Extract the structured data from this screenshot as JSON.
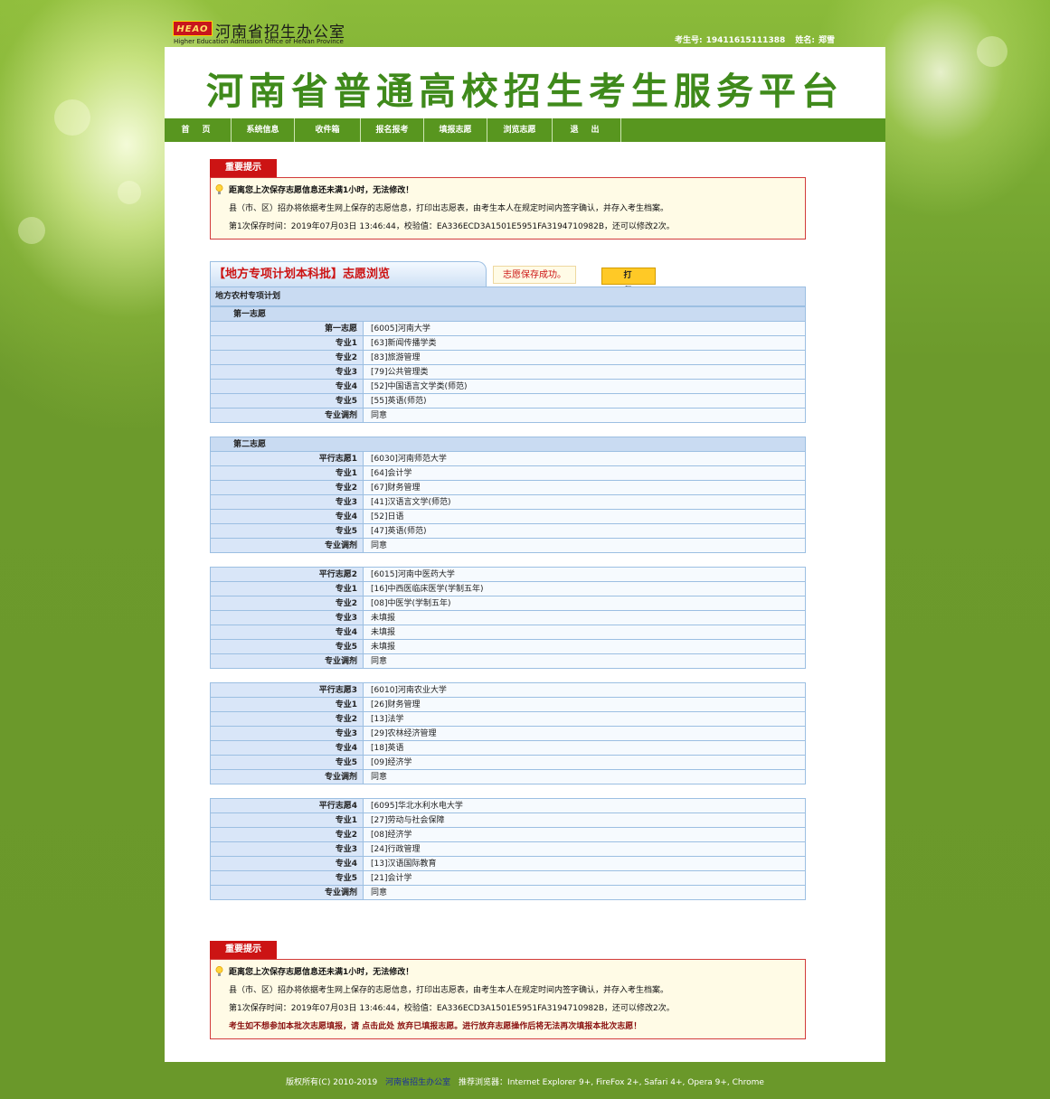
{
  "header": {
    "logo_badge": "HEAO",
    "logo_cn": "河南省招生办公室",
    "logo_en": "Higher Education Admission Office of HeNan Province",
    "exam_no_label": "考生号:",
    "exam_no": "19411615111388",
    "name_label": "姓名:",
    "name": "郑雪"
  },
  "banner_title": "河南省普通高校招生考生服务平台",
  "nav": [
    "首页",
    "系统信息",
    "收件箱",
    "报名报考",
    "填报志愿",
    "浏览志愿",
    "退出"
  ],
  "notice_top": {
    "tab": "重要提示",
    "lines": [
      "距离您上次保存志愿信息还未满1小时，无法修改！",
      "县（市、区）招办将依据考生网上保存的志愿信息，打印出志愿表，由考生本人在规定时间内签字确认，并存入考生档案。",
      "第1次保存时间：2019年07月03日 13:46:44，校验值：EA336ECD3A1501E5951FA3194710982B，还可以修改2次。"
    ]
  },
  "browse": {
    "title": "【地方专项计划本科批】志愿浏览",
    "saved_msg": "志愿保存成功。",
    "print_label": "打印"
  },
  "plan_title": "地方农村专项计划",
  "groups": [
    {
      "label": "第一志愿",
      "school_key": "第一志愿",
      "school": "[6005]河南大学",
      "majors": [
        "[63]新闻传播学类",
        "[83]旅游管理",
        "[79]公共管理类",
        "[52]中国语言文学类(师范)",
        "[55]英语(师范)"
      ],
      "adjust": "同意"
    },
    {
      "label": "第二志愿",
      "school_key": "平行志愿1",
      "school": "[6030]河南师范大学",
      "majors": [
        "[64]会计学",
        "[67]财务管理",
        "[41]汉语言文学(师范)",
        "[52]日语",
        "[47]英语(师范)"
      ],
      "adjust": "同意"
    },
    {
      "label": "",
      "school_key": "平行志愿2",
      "school": "[6015]河南中医药大学",
      "majors": [
        "[16]中西医临床医学(学制五年)",
        "[08]中医学(学制五年)",
        "未填报",
        "未填报",
        "未填报"
      ],
      "adjust": "同意"
    },
    {
      "label": "",
      "school_key": "平行志愿3",
      "school": "[6010]河南农业大学",
      "majors": [
        "[26]财务管理",
        "[13]法学",
        "[29]农林经济管理",
        "[18]英语",
        "[09]经济学"
      ],
      "adjust": "同意"
    },
    {
      "label": "",
      "school_key": "平行志愿4",
      "school": "[6095]华北水利水电大学",
      "majors": [
        "[27]劳动与社会保障",
        "[08]经济学",
        "[24]行政管理",
        "[13]汉语国际教育",
        "[21]会计学"
      ],
      "adjust": "同意"
    }
  ],
  "major_labels": [
    "专业1",
    "专业2",
    "专业3",
    "专业4",
    "专业5"
  ],
  "adjust_label": "专业调剂",
  "notice_bottom": {
    "tab": "重要提示",
    "lines": [
      "距离您上次保存志愿信息还未满1小时，无法修改！",
      "县（市、区）招办将依据考生网上保存的志愿信息，打印出志愿表，由考生本人在规定时间内签字确认，并存入考生档案。",
      "第1次保存时间：2019年07月03日 13:46:44，校验值：EA336ECD3A1501E5951FA3194710982B，还可以修改2次。",
      "考生如不想参加本批次志愿填报，请 点击此处 放弃已填报志愿。进行放弃志愿操作后将无法再次填报本批次志愿！"
    ]
  },
  "footer": {
    "copyright": "版权所有(C) 2010-2019",
    "org_link": "河南省招生办公室",
    "browsers": "推荐浏览器：Internet Explorer 9+, FireFox 2+, Safari 4+, Opera 9+, Chrome"
  }
}
